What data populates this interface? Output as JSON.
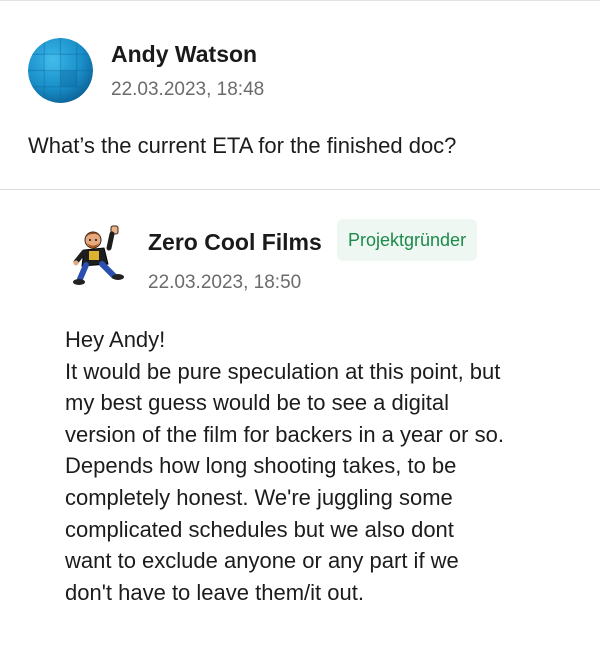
{
  "comments": [
    {
      "author": "Andy Watson",
      "timestamp": "22.03.2023, 18:48",
      "avatar_icon": "blue-globe-avatar",
      "body": "What’s the current ETA for the finished doc?"
    },
    {
      "author": "Zero Cool Films",
      "badge": "Projektgründer",
      "badge_color": "#1c8a4a",
      "timestamp": "22.03.2023, 18:50",
      "avatar_icon": "cartoon-character-avatar",
      "body_lines": [
        "Hey Andy!",
        "It would be pure speculation at this point, but",
        "my best guess would be to see a digital",
        "version of the film for backers in a year or so.",
        "Depends how long shooting takes, to be",
        "completely honest. We're juggling some",
        "complicated schedules but we also dont",
        "want to exclude anyone or any part if we",
        "don't have to leave them/it out."
      ]
    }
  ]
}
